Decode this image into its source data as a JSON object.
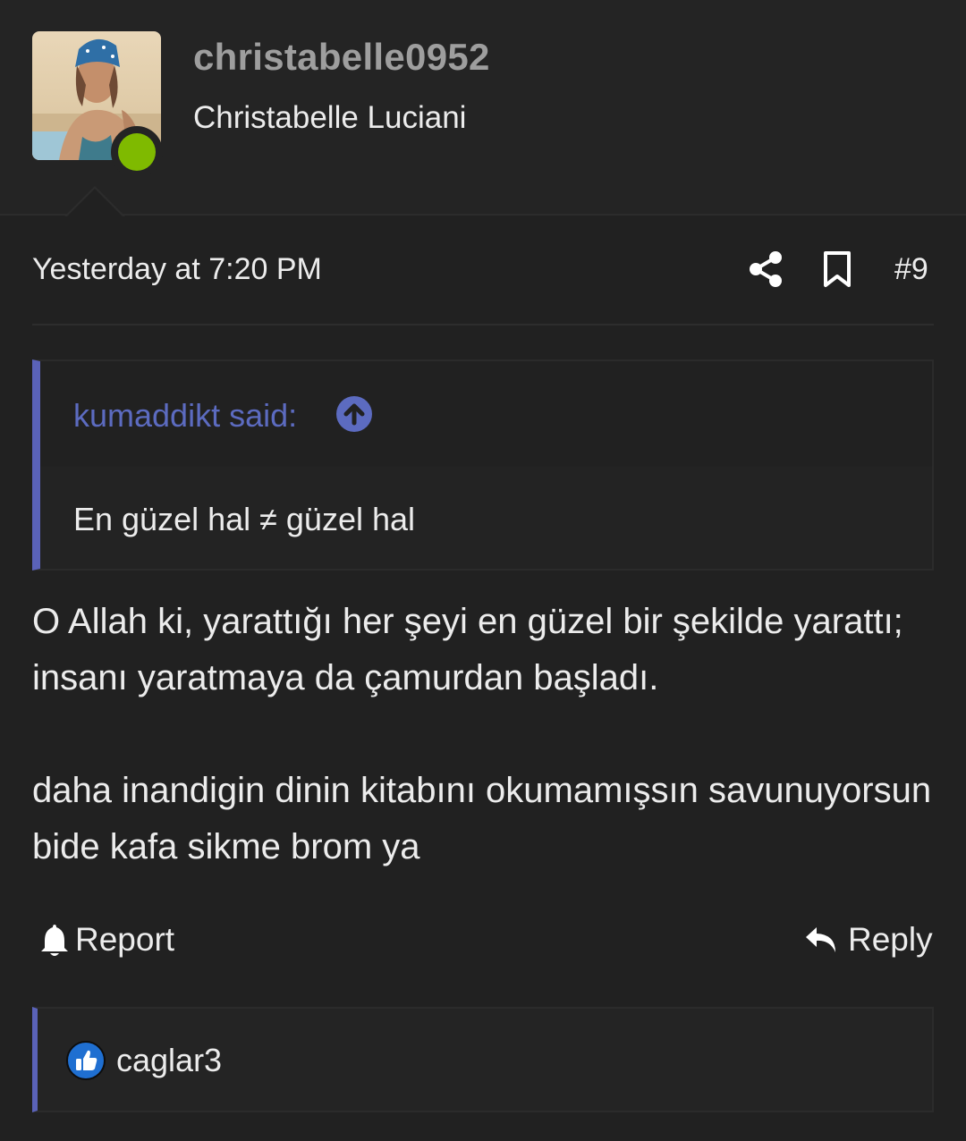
{
  "user": {
    "username": "christabelle0952",
    "real_name": "Christabelle Luciani",
    "status": "online",
    "status_color": "#7fba00"
  },
  "post": {
    "timestamp": "Yesterday at 7:20 PM",
    "number": "#9",
    "quote": {
      "author_label": "kumaddikt said:",
      "text": "En güzel hal ≠ güzel hal"
    },
    "message": {
      "paragraph_1": "O Allah ki, yarattığı her şeyi en güzel bir şekilde yarattı; insanı yaratmaya da çamurdan başladı.",
      "paragraph_2": "daha inandigin dinin kitabını okumamışsın savunuyorsun bide kafa sikme brom ya"
    },
    "actions": {
      "report_label": "Report",
      "reply_label": "Reply"
    },
    "reactions": {
      "users": "caglar3"
    }
  },
  "icons": {
    "share": "share-icon",
    "bookmark": "bookmark-icon",
    "quote_jump": "arrow-up-circle-icon",
    "report": "bell-icon",
    "reply": "reply-icon",
    "like": "thumbs-up-icon"
  },
  "colors": {
    "accent": "#5c6bc0",
    "background": "#212121",
    "online": "#7fba00"
  }
}
